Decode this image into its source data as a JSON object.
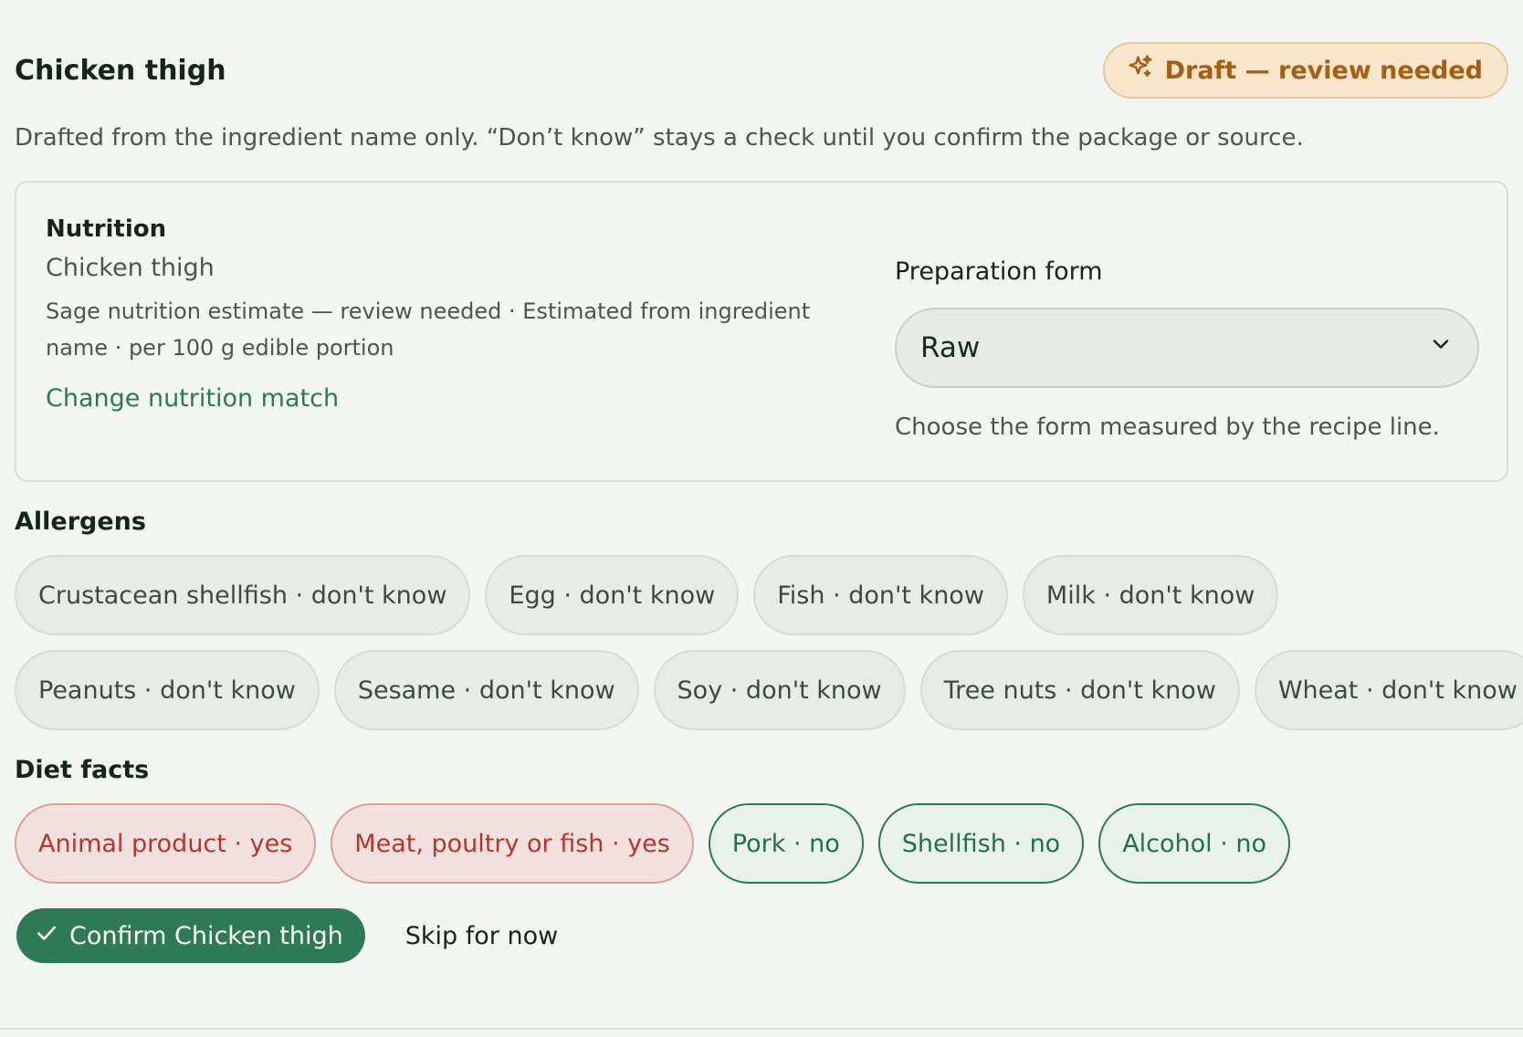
{
  "header": {
    "title": "Chicken thigh",
    "badge_label": "Draft — review needed"
  },
  "subtitle": "Drafted from the ingredient name only. “Don’t know” stays a check until you confirm the package or source.",
  "nutrition": {
    "heading": "Nutrition",
    "name": "Chicken thigh",
    "estimate": "Sage nutrition estimate — review needed · Estimated from ingredient name · per 100 g edible portion",
    "change_link": "Change nutrition match",
    "prep_label": "Preparation form",
    "prep_value": "Raw",
    "prep_help": "Choose the form measured by the recipe line."
  },
  "allergens": {
    "label": "Allergens",
    "row1": [
      "Crustacean shellfish · don't know",
      "Egg · don't know",
      "Fish · don't know",
      "Milk · don't know"
    ],
    "row2": [
      "Peanuts · don't know",
      "Sesame · don't know",
      "Soy · don't know",
      "Tree nuts · don't know",
      "Wheat · don't know"
    ]
  },
  "diet": {
    "label": "Diet facts",
    "chips": [
      {
        "label": "Animal product · yes",
        "state": "yes"
      },
      {
        "label": "Meat, poultry or fish · yes",
        "state": "yes"
      },
      {
        "label": "Pork · no",
        "state": "no"
      },
      {
        "label": "Shellfish · no",
        "state": "no"
      },
      {
        "label": "Alcohol · no",
        "state": "no"
      }
    ]
  },
  "actions": {
    "confirm_label": "Confirm Chicken thigh",
    "skip_label": "Skip for now"
  },
  "colors": {
    "accent_green": "#2f7a56",
    "draft_amber": "#a65f12",
    "yes_red": "#b7352d"
  },
  "icons": {
    "badge": "sparkle-icon",
    "select": "chevron-down-icon",
    "confirm": "check-icon"
  }
}
